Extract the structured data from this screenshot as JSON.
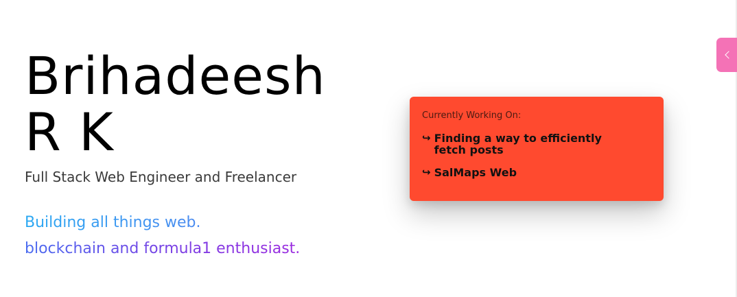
{
  "hero": {
    "name_line1": "Brihadeesh",
    "name_line2": "R K",
    "subtitle": "Full Stack Web Engineer and Freelancer",
    "tagline_line1": "Building all things web.",
    "tagline_line2": "blockchain and formula1 enthusiast."
  },
  "status_card": {
    "heading": "Currently Working On:",
    "items": [
      {
        "arrow": "↪",
        "label": "Finding a way to efficiently fetch posts"
      },
      {
        "arrow": "↪",
        "label": "SalMaps Web"
      }
    ],
    "background_color": "#ff4a2f"
  },
  "side_tab": {
    "icon": "chevron-left-icon",
    "color": "#f472b6"
  },
  "colors": {
    "tagline_gradient_start": "#2aa8f2",
    "tagline_gradient_end": "#9b2bdf"
  }
}
